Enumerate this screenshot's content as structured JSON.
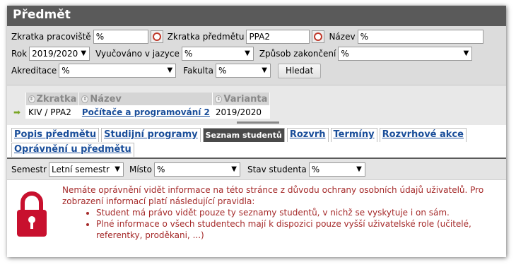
{
  "title": "Předmět",
  "filters": {
    "zkratka_pracoviste": {
      "label": "Zkratka pracoviště",
      "value": "%"
    },
    "zkratka_predmetu": {
      "label": "Zkratka předmětu",
      "value": "PPA2"
    },
    "nazev": {
      "label": "Název",
      "value": "%"
    },
    "rok": {
      "label": "Rok",
      "value": "2019/2020"
    },
    "vyucovano": {
      "label": "Vyučováno v jazyce",
      "value": "%"
    },
    "zpusob": {
      "label": "Způsob zakončení",
      "value": "%"
    },
    "akreditace": {
      "label": "Akreditace",
      "value": "%"
    },
    "fakulta": {
      "label": "Fakulta",
      "value": "%"
    },
    "search_button": "Hledat"
  },
  "results": {
    "columns": [
      "Zkratka",
      "Název",
      "Varianta"
    ],
    "rows": [
      {
        "zkratka": "KIV / PPA2",
        "nazev": "Počítače a programování 2",
        "varianta": "2019/2020"
      }
    ]
  },
  "tabs": [
    {
      "label": "Popis předmětu",
      "active": false
    },
    {
      "label": "Studijní programy",
      "active": false
    },
    {
      "label": "Seznam studentů",
      "active": true
    },
    {
      "label": "Rozvrh",
      "active": false
    },
    {
      "label": "Termíny",
      "active": false
    },
    {
      "label": "Rozvrhové akce",
      "active": false
    },
    {
      "label": "Oprávnění u předmětu",
      "active": false
    }
  ],
  "subfilters": {
    "semestr": {
      "label": "Semestr",
      "value": "Letní semestr"
    },
    "misto": {
      "label": "Místo",
      "value": "%"
    },
    "stav": {
      "label": "Stav studenta",
      "value": "%"
    }
  },
  "message": {
    "intro": "Nemáte oprávnění vidět informace na této stránce z důvodu ochrany osobních údajů uživatelů. Pro zobrazení informací platí následující pravidla:",
    "rules": [
      "Student má právo vidět pouze ty seznamy studentů, v nichž se vyskytuje i on sám.",
      "Plné informace o všech studentech mají k dispozici pouze vyšší uživatelské role (učitelé, referentky, proděkani, ...)"
    ]
  },
  "colors": {
    "titlebar": "#5a5a5a",
    "link": "#1a4e9a",
    "error": "#a52a2a",
    "lock": "#c8102e"
  }
}
